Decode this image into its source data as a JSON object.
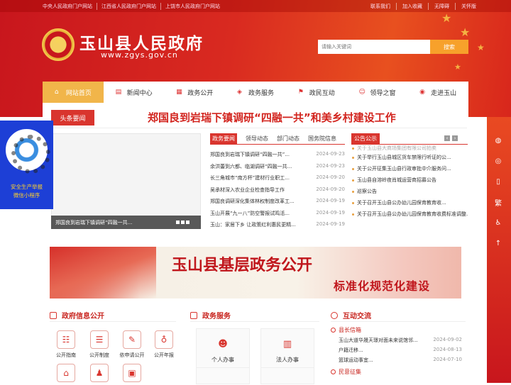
{
  "topbar": {
    "left_links": [
      "中央人民政府门户网站",
      "江西省人民政府门户网站",
      "上饶市人民政府门户网站"
    ],
    "right_links": [
      "联系我们",
      "加入收藏",
      "无障碍",
      "关怀版"
    ]
  },
  "header": {
    "title": "玉山县人民政府",
    "url": "www.zgys.gov.cn",
    "search_placeholder": "请输入关键词",
    "search_button": "搜索"
  },
  "nav": [
    {
      "label": "网站首页",
      "icon": "home-icon"
    },
    {
      "label": "新闻中心",
      "icon": "newspaper-icon"
    },
    {
      "label": "政务公开",
      "icon": "files-icon"
    },
    {
      "label": "政务服务",
      "icon": "layers-icon"
    },
    {
      "label": "政民互动",
      "icon": "flag-icon"
    },
    {
      "label": "领导之窗",
      "icon": "user-icon"
    },
    {
      "label": "走进玉山",
      "icon": "location-icon"
    }
  ],
  "headline": {
    "tag": "头条要闻",
    "text": "郑国良到岩瑞下镇调研“四融一共”和美乡村建设工作"
  },
  "slider": {
    "caption": "郑国良到岩瑞下镇调研“四融一共..."
  },
  "news": {
    "tabs": [
      "政务要闻",
      "领导动态",
      "部门动态",
      "国务院信息"
    ],
    "items": [
      {
        "title": "郑国良到岩瑞下镇调研“四融一共”...",
        "date": "2024-09-23"
      },
      {
        "title": "余洪蕾到六都、临湖调研“四融一共...",
        "date": "2024-09-23"
      },
      {
        "title": "长三角城市“南方杯”建材行业职工...",
        "date": "2024-09-20"
      },
      {
        "title": "吴承材深入农业企业检查指导工作",
        "date": "2024-09-20"
      },
      {
        "title": "郑国良调研深化集体林权制度改革工...",
        "date": "2024-09-19"
      },
      {
        "title": "玉山开展“九一八”防空警报试鸣活...",
        "date": "2024-09-19"
      },
      {
        "title": "玉山：家居下乡 让政策红利惠民更精...",
        "date": "2024-09-19"
      }
    ]
  },
  "notices": {
    "tag": "公告公示",
    "items": [
      "关于玉山县大商场集团有限公司拍卖",
      "关于举行玉山县城区货车禁限行听证的公...",
      "关于公开征集玉山县行政审批中介服务问...",
      "玉山县自溶岭夜肖城运营商招募公告",
      "巡察公告",
      "关于召开玉山县公办幼儿园保育教育收...",
      "关于召开玉山县公办幼儿园保育教育收费标准调整..."
    ]
  },
  "banner": {
    "line1": "玉山县基层政务公开",
    "line2": "标准化规范化建设"
  },
  "gov_info": {
    "title": "政府信息公开",
    "items": [
      {
        "label": "公开指南",
        "icon": "guide-icon"
      },
      {
        "label": "公开制度",
        "icon": "list-icon"
      },
      {
        "label": "依申请公开",
        "icon": "edit-icon"
      },
      {
        "label": "公开年报",
        "icon": "network-icon"
      }
    ]
  },
  "gov_service": {
    "title": "政务服务",
    "items": [
      {
        "label": "个人办事",
        "icon": "person-icon"
      },
      {
        "label": "法人办事",
        "icon": "building-icon"
      }
    ]
  },
  "interaction": {
    "title": "互动交流",
    "mailbox_title": "县长信箱",
    "mailbox": [
      {
        "title": "玉山大道华晟天璟对面未来说馆邻...",
        "date": "2024-09-02"
      },
      {
        "title": "户籍迁移...",
        "date": "2024-08-13"
      },
      {
        "title": "篮球运动事宜...",
        "date": "2024-07-10"
      }
    ],
    "survey_title": "民意征集"
  },
  "qr_panel": {
    "line1": "安全生产举报",
    "line2": "微信小程序"
  },
  "side_bar": [
    "wechat-icon",
    "weibo-icon",
    "mobile-icon",
    "繁",
    "accessibility-icon",
    "top-icon"
  ],
  "colors": {
    "brand_red": "#c8161d",
    "accent_orange": "#f7a12b",
    "qr_blue": "#1d3fd6"
  }
}
